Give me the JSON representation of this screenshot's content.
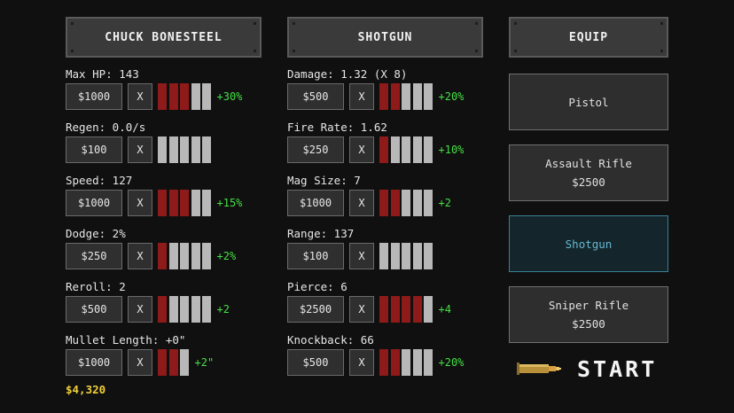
{
  "headers": {
    "character": "CHUCK BONESTEEL",
    "weapon": "SHOTGUN",
    "equip": "EQUIP"
  },
  "character_stats": [
    {
      "label": "Max HP: 143",
      "cost": "$1000",
      "x": "X",
      "filled": 3,
      "total": 5,
      "bonus": "+30%"
    },
    {
      "label": "Regen: 0.0/s",
      "cost": "$100",
      "x": "X",
      "filled": 0,
      "total": 5,
      "bonus": ""
    },
    {
      "label": "Speed: 127",
      "cost": "$1000",
      "x": "X",
      "filled": 3,
      "total": 5,
      "bonus": "+15%"
    },
    {
      "label": "Dodge: 2%",
      "cost": "$250",
      "x": "X",
      "filled": 1,
      "total": 5,
      "bonus": "+2%"
    },
    {
      "label": "Reroll: 2",
      "cost": "$500",
      "x": "X",
      "filled": 1,
      "total": 5,
      "bonus": "+2"
    },
    {
      "label": "Mullet Length: +0\"",
      "cost": "$1000",
      "x": "X",
      "filled": 2,
      "total": 3,
      "bonus": "+2\""
    }
  ],
  "weapon_stats": [
    {
      "label": "Damage: 1.32 (X 8)",
      "cost": "$500",
      "x": "X",
      "filled": 2,
      "total": 5,
      "bonus": "+20%"
    },
    {
      "label": "Fire Rate: 1.62",
      "cost": "$250",
      "x": "X",
      "filled": 1,
      "total": 5,
      "bonus": "+10%"
    },
    {
      "label": "Mag Size: 7",
      "cost": "$1000",
      "x": "X",
      "filled": 2,
      "total": 5,
      "bonus": "+2"
    },
    {
      "label": "Range: 137",
      "cost": "$100",
      "x": "X",
      "filled": 0,
      "total": 5,
      "bonus": ""
    },
    {
      "label": "Pierce: 6",
      "cost": "$2500",
      "x": "X",
      "filled": 4,
      "total": 5,
      "bonus": "+4"
    },
    {
      "label": "Knockback: 66",
      "cost": "$500",
      "x": "X",
      "filled": 2,
      "total": 5,
      "bonus": "+20%"
    }
  ],
  "money": "$4,320",
  "equip_list": [
    {
      "name": "Pistol",
      "price": "",
      "selected": false
    },
    {
      "name": "Assault Rifle",
      "price": "$2500",
      "selected": false
    },
    {
      "name": "Shotgun",
      "price": "",
      "selected": true
    },
    {
      "name": "Sniper Rifle",
      "price": "$2500",
      "selected": false
    }
  ],
  "start_label": "START",
  "start_icon": "bullet-icon",
  "colors": {
    "bar_filled": "#8f1a1a",
    "bar_empty": "#b8b8b8",
    "bonus": "#44e044",
    "money": "#f0d03a",
    "selected_border": "#3a8096",
    "selected_text": "#68b8d0"
  }
}
